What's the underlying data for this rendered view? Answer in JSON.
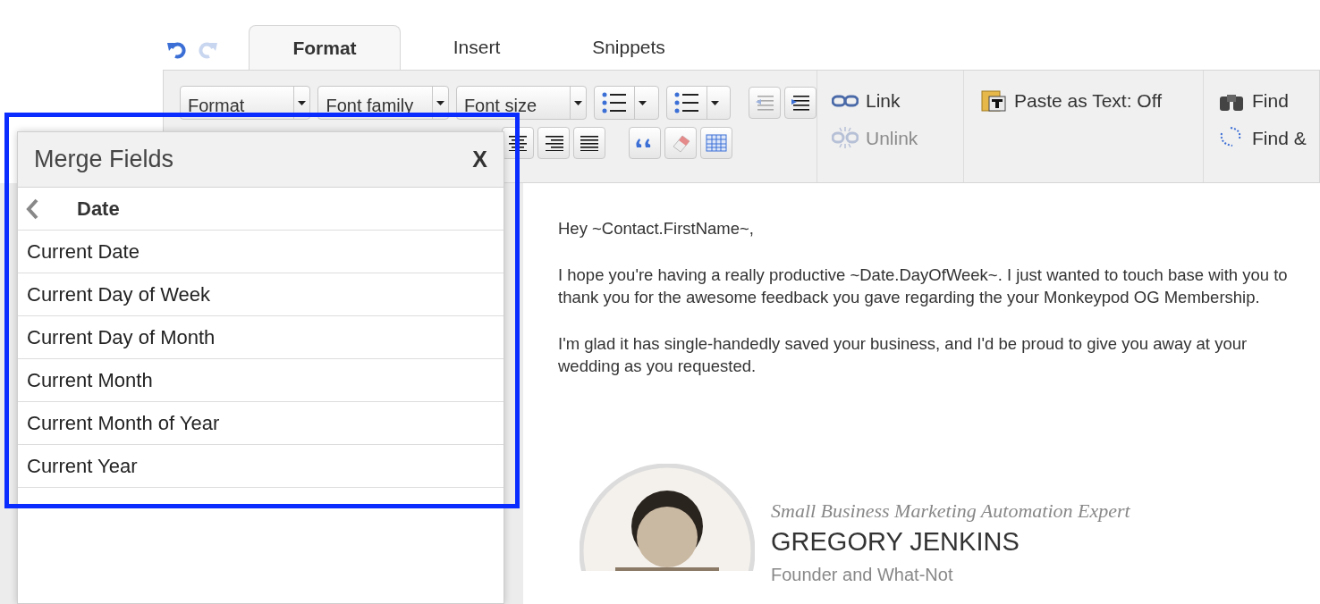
{
  "tabs": [
    {
      "label": "Format",
      "selected": true
    },
    {
      "label": "Insert",
      "selected": false
    },
    {
      "label": "Snippets",
      "selected": false
    }
  ],
  "toolbar": {
    "dropdowns": [
      "Format",
      "Font family",
      "Font size"
    ],
    "links": [
      {
        "label": "Link",
        "disabled": false,
        "kind": "link"
      },
      {
        "label": "Unlink",
        "disabled": true,
        "kind": "unlink"
      }
    ],
    "paste": "Paste as Text: Off",
    "find": [
      {
        "label": "Find",
        "kind": "find"
      },
      {
        "label": "Find &",
        "kind": "replace"
      }
    ]
  },
  "merge_fields": {
    "title": "Merge Fields",
    "close": "X",
    "category": "Date",
    "items": [
      "Current Date",
      "Current Day of Week",
      "Current Day of Month",
      "Current Month",
      "Current Month of Year",
      "Current Year"
    ]
  },
  "editor": {
    "paragraphs": [
      "Hey ~Contact.FirstName~,",
      "I hope you're having a really productive ~Date.DayOfWeek~. I just wanted to touch base with you to thank you for the awesome feedback you gave regarding the your Monkeypod OG Membership.",
      "I'm glad it has single-handedly saved your business, and I'd be proud to give you away at your wedding as you requested."
    ],
    "signature": {
      "tagline": "Small Business Marketing Automation Expert",
      "name": "GREGORY JENKINS",
      "role": "Founder and What-Not"
    }
  }
}
